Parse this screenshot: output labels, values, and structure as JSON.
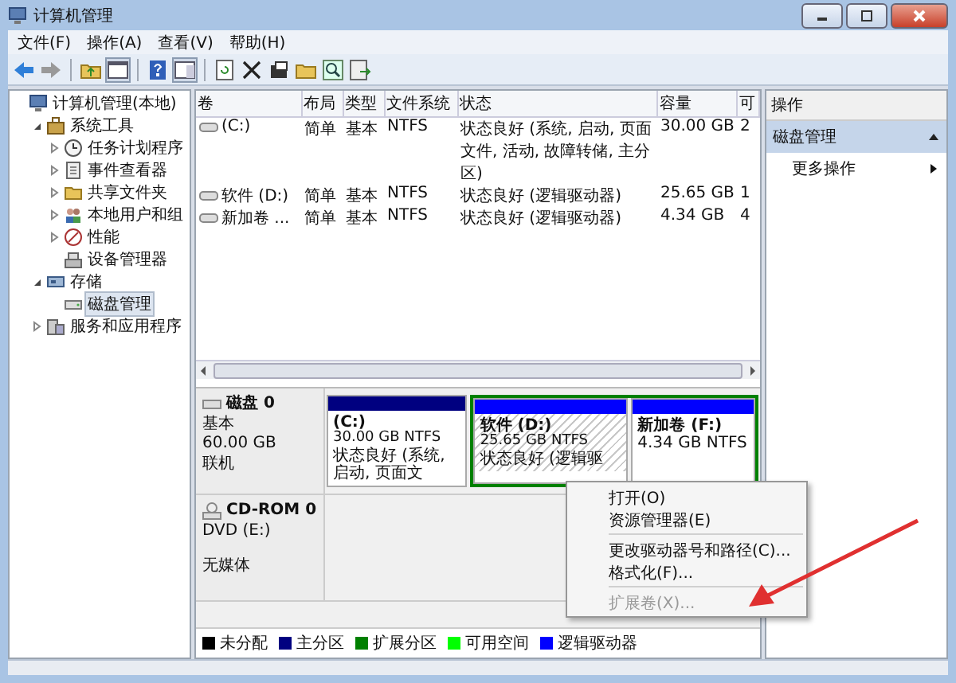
{
  "window": {
    "title": "计算机管理"
  },
  "menu": [
    "文件(F)",
    "操作(A)",
    "查看(V)",
    "帮助(H)"
  ],
  "tree": [
    {
      "label": "计算机管理(本地)",
      "kind": "computer",
      "selected": false,
      "children": [
        {
          "label": "系统工具",
          "kind": "tools",
          "expanded": true,
          "selected": false,
          "children": [
            {
              "label": "任务计划程序",
              "kind": "clock",
              "expanded": false,
              "selected": false
            },
            {
              "label": "事件查看器",
              "kind": "log",
              "expanded": false,
              "selected": false
            },
            {
              "label": "共享文件夹",
              "kind": "share",
              "expanded": false,
              "selected": false
            },
            {
              "label": "本地用户和组",
              "kind": "users",
              "expanded": false,
              "selected": false
            },
            {
              "label": "性能",
              "kind": "perf",
              "expanded": false,
              "selected": false
            },
            {
              "label": "设备管理器",
              "kind": "device",
              "selected": false
            }
          ]
        },
        {
          "label": "存储",
          "kind": "storage",
          "expanded": true,
          "selected": false,
          "children": [
            {
              "label": "磁盘管理",
              "kind": "disk",
              "selected": true
            }
          ]
        },
        {
          "label": "服务和应用程序",
          "kind": "services",
          "expanded": false,
          "selected": false
        }
      ]
    }
  ],
  "table": {
    "columns": [
      "卷",
      "布局",
      "类型",
      "文件系统",
      "状态",
      "容量",
      "可"
    ],
    "rows": [
      [
        "(C:)",
        "简单",
        "基本",
        "NTFS",
        "状态良好 (系统, 启动, 页面文件, 活动, 故障转储, 主分区)",
        "30.00 GB",
        "2"
      ],
      [
        "软件 (D:)",
        "简单",
        "基本",
        "NTFS",
        "状态良好 (逻辑驱动器)",
        "25.65 GB",
        "1"
      ],
      [
        "新加卷 ...",
        "简单",
        "基本",
        "NTFS",
        "状态良好 (逻辑驱动器)",
        "4.34 GB",
        "4"
      ]
    ]
  },
  "disks": [
    {
      "kind": "hdd",
      "name": "磁盘 0",
      "type": "基本",
      "size": "60.00 GB",
      "status": "联机",
      "partitions": [
        {
          "kind": "primary",
          "name": "(C:)",
          "size": "30.00 GB NTFS",
          "status": "状态良好 (系统, 启动, 页面文",
          "selected": false
        },
        {
          "kind": "logical",
          "name": "软件 (D:)",
          "size": "25.65 GB NTFS",
          "status": "状态良好 (逻辑驱",
          "selected": true
        },
        {
          "kind": "logical",
          "name": "新加卷 (F:)",
          "size": "4.34 GB NTFS",
          "selected": false
        }
      ]
    },
    {
      "kind": "cdrom",
      "name": "CD-ROM 0",
      "type": "DVD (E:)",
      "status": "无媒体"
    }
  ],
  "legend": [
    {
      "label": "未分配",
      "color": "#000000"
    },
    {
      "label": "主分区",
      "color": "#000080"
    },
    {
      "label": "扩展分区",
      "color": "#008000"
    },
    {
      "label": "可用空间",
      "color": "#00ff00"
    },
    {
      "label": "逻辑驱动器",
      "color": "#0000ff"
    }
  ],
  "context_menu": [
    {
      "label": "打开(O)",
      "disabled": false,
      "separator_before": false
    },
    {
      "label": "资源管理器(E)",
      "disabled": false,
      "separator_before": false
    },
    {
      "label": "更改驱动器号和路径(C)...",
      "disabled": false,
      "separator_before": true
    },
    {
      "label": "格式化(F)...",
      "disabled": false,
      "separator_before": false
    },
    {
      "label": "扩展卷(X)...",
      "disabled": true,
      "separator_before": true
    }
  ],
  "actions": {
    "header": "操作",
    "sections": [
      {
        "title": "磁盘管理",
        "expanded": true,
        "items": [
          "更多操作"
        ]
      }
    ]
  }
}
